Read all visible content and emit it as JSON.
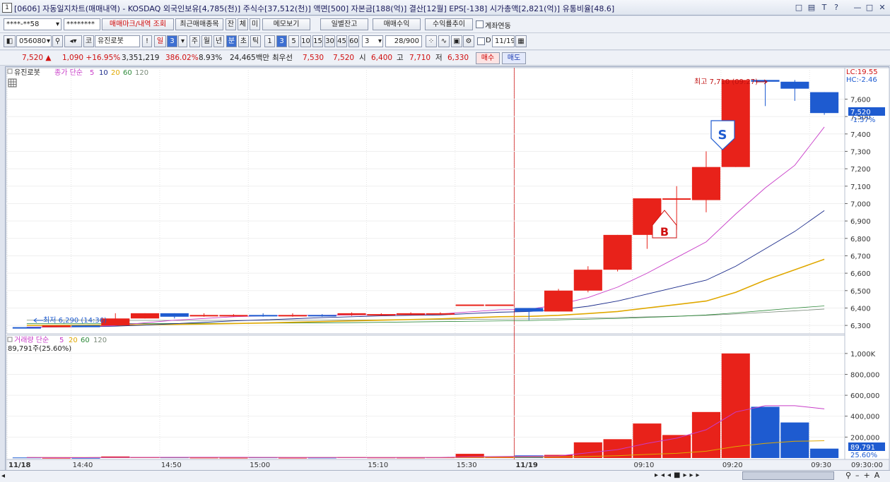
{
  "window": {
    "number": "1",
    "title": "[0606] 자동일지차트(매매내역) - KOSDAQ 외국인보유[4,785(천)] 주식수[37,512(천)] 액면[500] 자본금[188(억)] 결산[12월] EPS[-138] 시가총액[2,821(억)] 유통비율[48.6]",
    "controls": [
      "□",
      "▤",
      "T",
      "?",
      "—",
      "□",
      "✕"
    ]
  },
  "toolbar1": {
    "account": "****-**58",
    "password": "********",
    "btn_trade_mark": "매매마크/내역 조회",
    "btn_recent": "최근매매종목",
    "btn_jan": "잔",
    "btn_che": "체",
    "btn_mi": "미",
    "btn_memo": "메모보기",
    "btn_daily_balance": "일별잔고",
    "btn_trade_profit": "매매수익",
    "btn_return_rate": "수익률추이",
    "link_account_label": "계좌연동"
  },
  "toolbar2": {
    "code": "056080",
    "stock_name": "유진로봇",
    "type_prefix": "코",
    "excl": "!",
    "period_il": "일",
    "period_il_val": "3",
    "periods": [
      "주",
      "월",
      "년",
      "분",
      "초",
      "틱"
    ],
    "selected_period": "분",
    "intervals": [
      "1",
      "3",
      "5",
      "10",
      "15",
      "30",
      "45",
      "60"
    ],
    "selected_interval": "3",
    "interval_value": "3",
    "count": "28",
    "count_total": "/900",
    "d_label": "D",
    "date": "11/19"
  },
  "info": {
    "price": "7,520",
    "arrow": "▲",
    "change": "1,090",
    "change_pct": "+16.95%",
    "volume": "3,351,219",
    "vol_ratio": "386.02%",
    "turnover": "8.93%",
    "amount": "24,465백만",
    "best_ask_label": "최우선",
    "best_ask": "7,530",
    "best_bid": "7,520",
    "open_label": "시",
    "open": "6,400",
    "high_label": "고",
    "high": "7,710",
    "low_label": "저",
    "low": "6,330",
    "buy_btn": "매수",
    "sell_btn": "매도"
  },
  "price_panel": {
    "stock_label": "유진로봇",
    "ma_label": "종가 단순",
    "ma_periods": [
      "5",
      "10",
      "20",
      "60",
      "120"
    ],
    "ma_colors": [
      "#c83cc8",
      "#1a2a8a",
      "#e0a800",
      "#2e8a3a",
      "#7a8a7a"
    ],
    "lc": "LC:19.55",
    "hc": "HC:-2.46",
    "max_label": "최고 7,710 (09:27)",
    "min_label": "최저 6,290 (14:36)",
    "last_price_tag": "7,520",
    "last_pct_tag": "-1.57%",
    "buy_marker": "B",
    "sell_marker": "S",
    "yticks": [
      "7,600",
      "7,500",
      "7,400",
      "7,300",
      "7,200",
      "7,100",
      "7,000",
      "6,900",
      "6,800",
      "6,700",
      "6,600",
      "6,500",
      "6,400",
      "6,300"
    ],
    "up_color": "#e8221a",
    "down_color": "#1e5bd0"
  },
  "volume_panel": {
    "label": "거래량 단순",
    "ma_periods": [
      "5",
      "20",
      "60",
      "120"
    ],
    "value_text": "89,791주(25.60%)",
    "yticks": [
      "1,000K",
      "800,000",
      "600,000",
      "400,000",
      "200,000"
    ],
    "last_tag": "89,791",
    "last_pct": "25.60%"
  },
  "xaxis": {
    "labels": [
      "11/18",
      "14:40",
      "14:50",
      "15:00",
      "15:10",
      "15:30",
      "11/19",
      "09:10",
      "09:20",
      "09:30"
    ],
    "end_label": "09:30:00"
  },
  "chart_data": {
    "type": "candlestick",
    "candles": [
      {
        "o": 6290,
        "h": 6290,
        "l": 6290,
        "c": 6290,
        "up": false
      },
      {
        "o": 6290,
        "h": 6300,
        "l": 6290,
        "c": 6300,
        "up": true
      },
      {
        "o": 6300,
        "h": 6300,
        "l": 6290,
        "c": 6290,
        "up": false
      },
      {
        "o": 6300,
        "h": 6370,
        "l": 6300,
        "c": 6340,
        "up": true
      },
      {
        "o": 6340,
        "h": 6370,
        "l": 6340,
        "c": 6370,
        "up": true
      },
      {
        "o": 6370,
        "h": 6370,
        "l": 6340,
        "c": 6350,
        "up": false
      },
      {
        "o": 6355,
        "h": 6370,
        "l": 6350,
        "c": 6360,
        "up": true
      },
      {
        "o": 6355,
        "h": 6365,
        "l": 6350,
        "c": 6360,
        "up": true
      },
      {
        "o": 6360,
        "h": 6370,
        "l": 6350,
        "c": 6355,
        "up": false
      },
      {
        "o": 6355,
        "h": 6370,
        "l": 6350,
        "c": 6360,
        "up": true
      },
      {
        "o": 6360,
        "h": 6365,
        "l": 6350,
        "c": 6355,
        "up": false
      },
      {
        "o": 6360,
        "h": 6375,
        "l": 6355,
        "c": 6370,
        "up": true
      },
      {
        "o": 6360,
        "h": 6370,
        "l": 6355,
        "c": 6365,
        "up": true
      },
      {
        "o": 6360,
        "h": 6375,
        "l": 6360,
        "c": 6370,
        "up": true
      },
      {
        "o": 6365,
        "h": 6375,
        "l": 6360,
        "c": 6370,
        "up": true
      },
      {
        "o": 6420,
        "h": 6420,
        "l": 6420,
        "c": 6420,
        "up": true
      },
      {
        "o": 6420,
        "h": 6420,
        "l": 6420,
        "c": 6420,
        "up": true
      },
      {
        "o": 6400,
        "h": 6400,
        "l": 6330,
        "c": 6380,
        "up": false
      },
      {
        "o": 6380,
        "h": 6510,
        "l": 6380,
        "c": 6500,
        "up": true
      },
      {
        "o": 6500,
        "h": 6640,
        "l": 6490,
        "c": 6620,
        "up": true
      },
      {
        "o": 6620,
        "h": 6820,
        "l": 6610,
        "c": 6820,
        "up": true
      },
      {
        "o": 6820,
        "h": 7030,
        "l": 6740,
        "c": 7030,
        "up": true
      },
      {
        "o": 7030,
        "h": 7100,
        "l": 6850,
        "c": 7030,
        "up": true
      },
      {
        "o": 7020,
        "h": 7300,
        "l": 6950,
        "c": 7210,
        "up": true
      },
      {
        "o": 7210,
        "h": 7710,
        "l": 7210,
        "c": 7710,
        "up": true
      },
      {
        "o": 7710,
        "h": 7710,
        "l": 7560,
        "c": 7700,
        "up": false
      },
      {
        "o": 7700,
        "h": 7710,
        "l": 7590,
        "c": 7660,
        "up": false
      },
      {
        "o": 7640,
        "h": 7640,
        "l": 7510,
        "c": 7520,
        "up": false
      }
    ],
    "ma5": [
      6290,
      6292,
      6293,
      6300,
      6315,
      6330,
      6340,
      6350,
      6355,
      6358,
      6358,
      6360,
      6362,
      6364,
      6366,
      6378,
      6390,
      6392,
      6420,
      6460,
      6520,
      6600,
      6690,
      6780,
      6940,
      7090,
      7220,
      7440
    ],
    "ma10": [
      6290,
      6291,
      6292,
      6296,
      6302,
      6310,
      6318,
      6326,
      6332,
      6338,
      6345,
      6350,
      6355,
      6358,
      6360,
      6368,
      6376,
      6380,
      6390,
      6410,
      6440,
      6480,
      6520,
      6560,
      6640,
      6740,
      6840,
      6960
    ],
    "ma20": [
      6300,
      6300,
      6301,
      6302,
      6304,
      6306,
      6308,
      6311,
      6314,
      6318,
      6322,
      6326,
      6330,
      6334,
      6338,
      6344,
      6350,
      6352,
      6358,
      6368,
      6380,
      6400,
      6420,
      6440,
      6490,
      6560,
      6620,
      6680
    ],
    "ma60": [
      6310,
      6310,
      6310,
      6310,
      6311,
      6311,
      6312,
      6312,
      6313,
      6314,
      6315,
      6316,
      6318,
      6320,
      6322,
      6324,
      6326,
      6328,
      6332,
      6336,
      6340,
      6346,
      6352,
      6360,
      6372,
      6386,
      6400,
      6412
    ],
    "ma120": [
      6330,
      6330,
      6330,
      6329,
      6329,
      6329,
      6329,
      6329,
      6330,
      6330,
      6330,
      6331,
      6332,
      6333,
      6334,
      6335,
      6336,
      6337,
      6339,
      6342,
      6345,
      6349,
      6353,
      6358,
      6366,
      6375,
      6384,
      6394
    ],
    "volume": [
      5000,
      2000,
      1500,
      15000,
      8000,
      6000,
      4000,
      3000,
      6000,
      3000,
      4000,
      8000,
      5000,
      4000,
      6000,
      40000,
      15000,
      25000,
      30000,
      150000,
      180000,
      330000,
      220000,
      440000,
      1000000,
      490000,
      340000,
      89791
    ],
    "vol_ma5": [
      5000,
      4000,
      3500,
      6000,
      6300,
      7000,
      7000,
      7000,
      6000,
      5000,
      5000,
      5000,
      5000,
      5000,
      5000,
      12000,
      14000,
      17000,
      20000,
      50000,
      80000,
      140000,
      190000,
      270000,
      440000,
      500000,
      500000,
      470000
    ],
    "vol_ma20": [
      5000,
      5000,
      5000,
      5000,
      5000,
      5000,
      5000,
      5000,
      5000,
      5000,
      5000,
      5000,
      5000,
      5000,
      5000,
      6000,
      7000,
      8000,
      9000,
      15000,
      22000,
      35000,
      45000,
      65000,
      110000,
      140000,
      160000,
      165000
    ],
    "ylim": [
      6260,
      7760
    ],
    "vol_ylim": [
      0,
      1080000
    ]
  }
}
